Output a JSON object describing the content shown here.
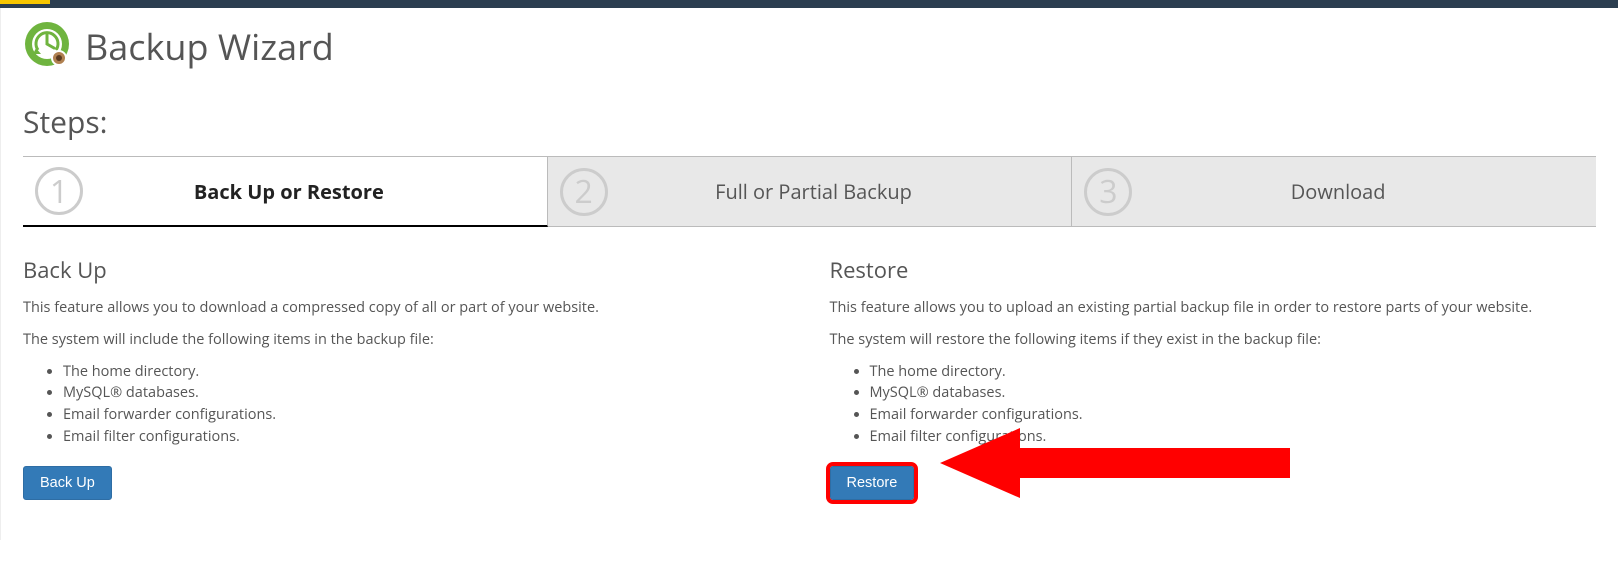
{
  "header": {
    "title": "Backup Wizard"
  },
  "steps": {
    "label": "Steps:",
    "items": [
      {
        "num": "1",
        "label": "Back Up or Restore",
        "active": true
      },
      {
        "num": "2",
        "label": "Full or Partial Backup",
        "active": false
      },
      {
        "num": "3",
        "label": "Download",
        "active": false
      }
    ]
  },
  "backup": {
    "heading": "Back Up",
    "desc": "This feature allows you to download a compressed copy of all or part of your website.",
    "sub": "The system will include the following items in the backup file:",
    "items": [
      "The home directory.",
      "MySQL® databases.",
      "Email forwarder configurations.",
      "Email filter configurations."
    ],
    "button": "Back Up"
  },
  "restore": {
    "heading": "Restore",
    "desc": "This feature allows you to upload an existing partial backup file in order to restore parts of your website.",
    "sub": "The system will restore the following items if they exist in the backup file:",
    "items": [
      "The home directory.",
      "MySQL® databases.",
      "Email forwarder configurations.",
      "Email filter configurations."
    ],
    "button": "Restore"
  }
}
